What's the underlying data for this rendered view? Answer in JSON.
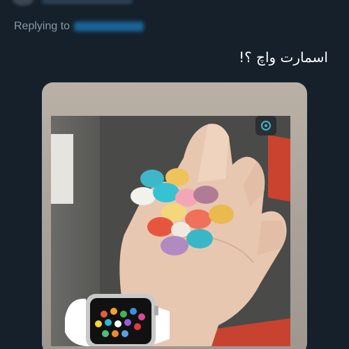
{
  "reply": {
    "label": "Replying to",
    "handle_blurred": true
  },
  "tweet": {
    "text": "اسمارت واچ ؟!"
  },
  "media": {
    "description_icon": "photo-hand-with-candies-and-smartwatch",
    "candy_colors": [
      "#3fb7c9",
      "#f0c35a",
      "#f3f1ec",
      "#36c2d3",
      "#f3a7b6",
      "#b07c95",
      "#f3d77a",
      "#e6563f",
      "#eeeae0",
      "#f0705a",
      "#b18ac2",
      "#3ab7c5",
      "#eab94f"
    ]
  },
  "colors": {
    "background": "#15202b",
    "secondary_text": "#8899a6",
    "accent": "#1d9bf0"
  }
}
